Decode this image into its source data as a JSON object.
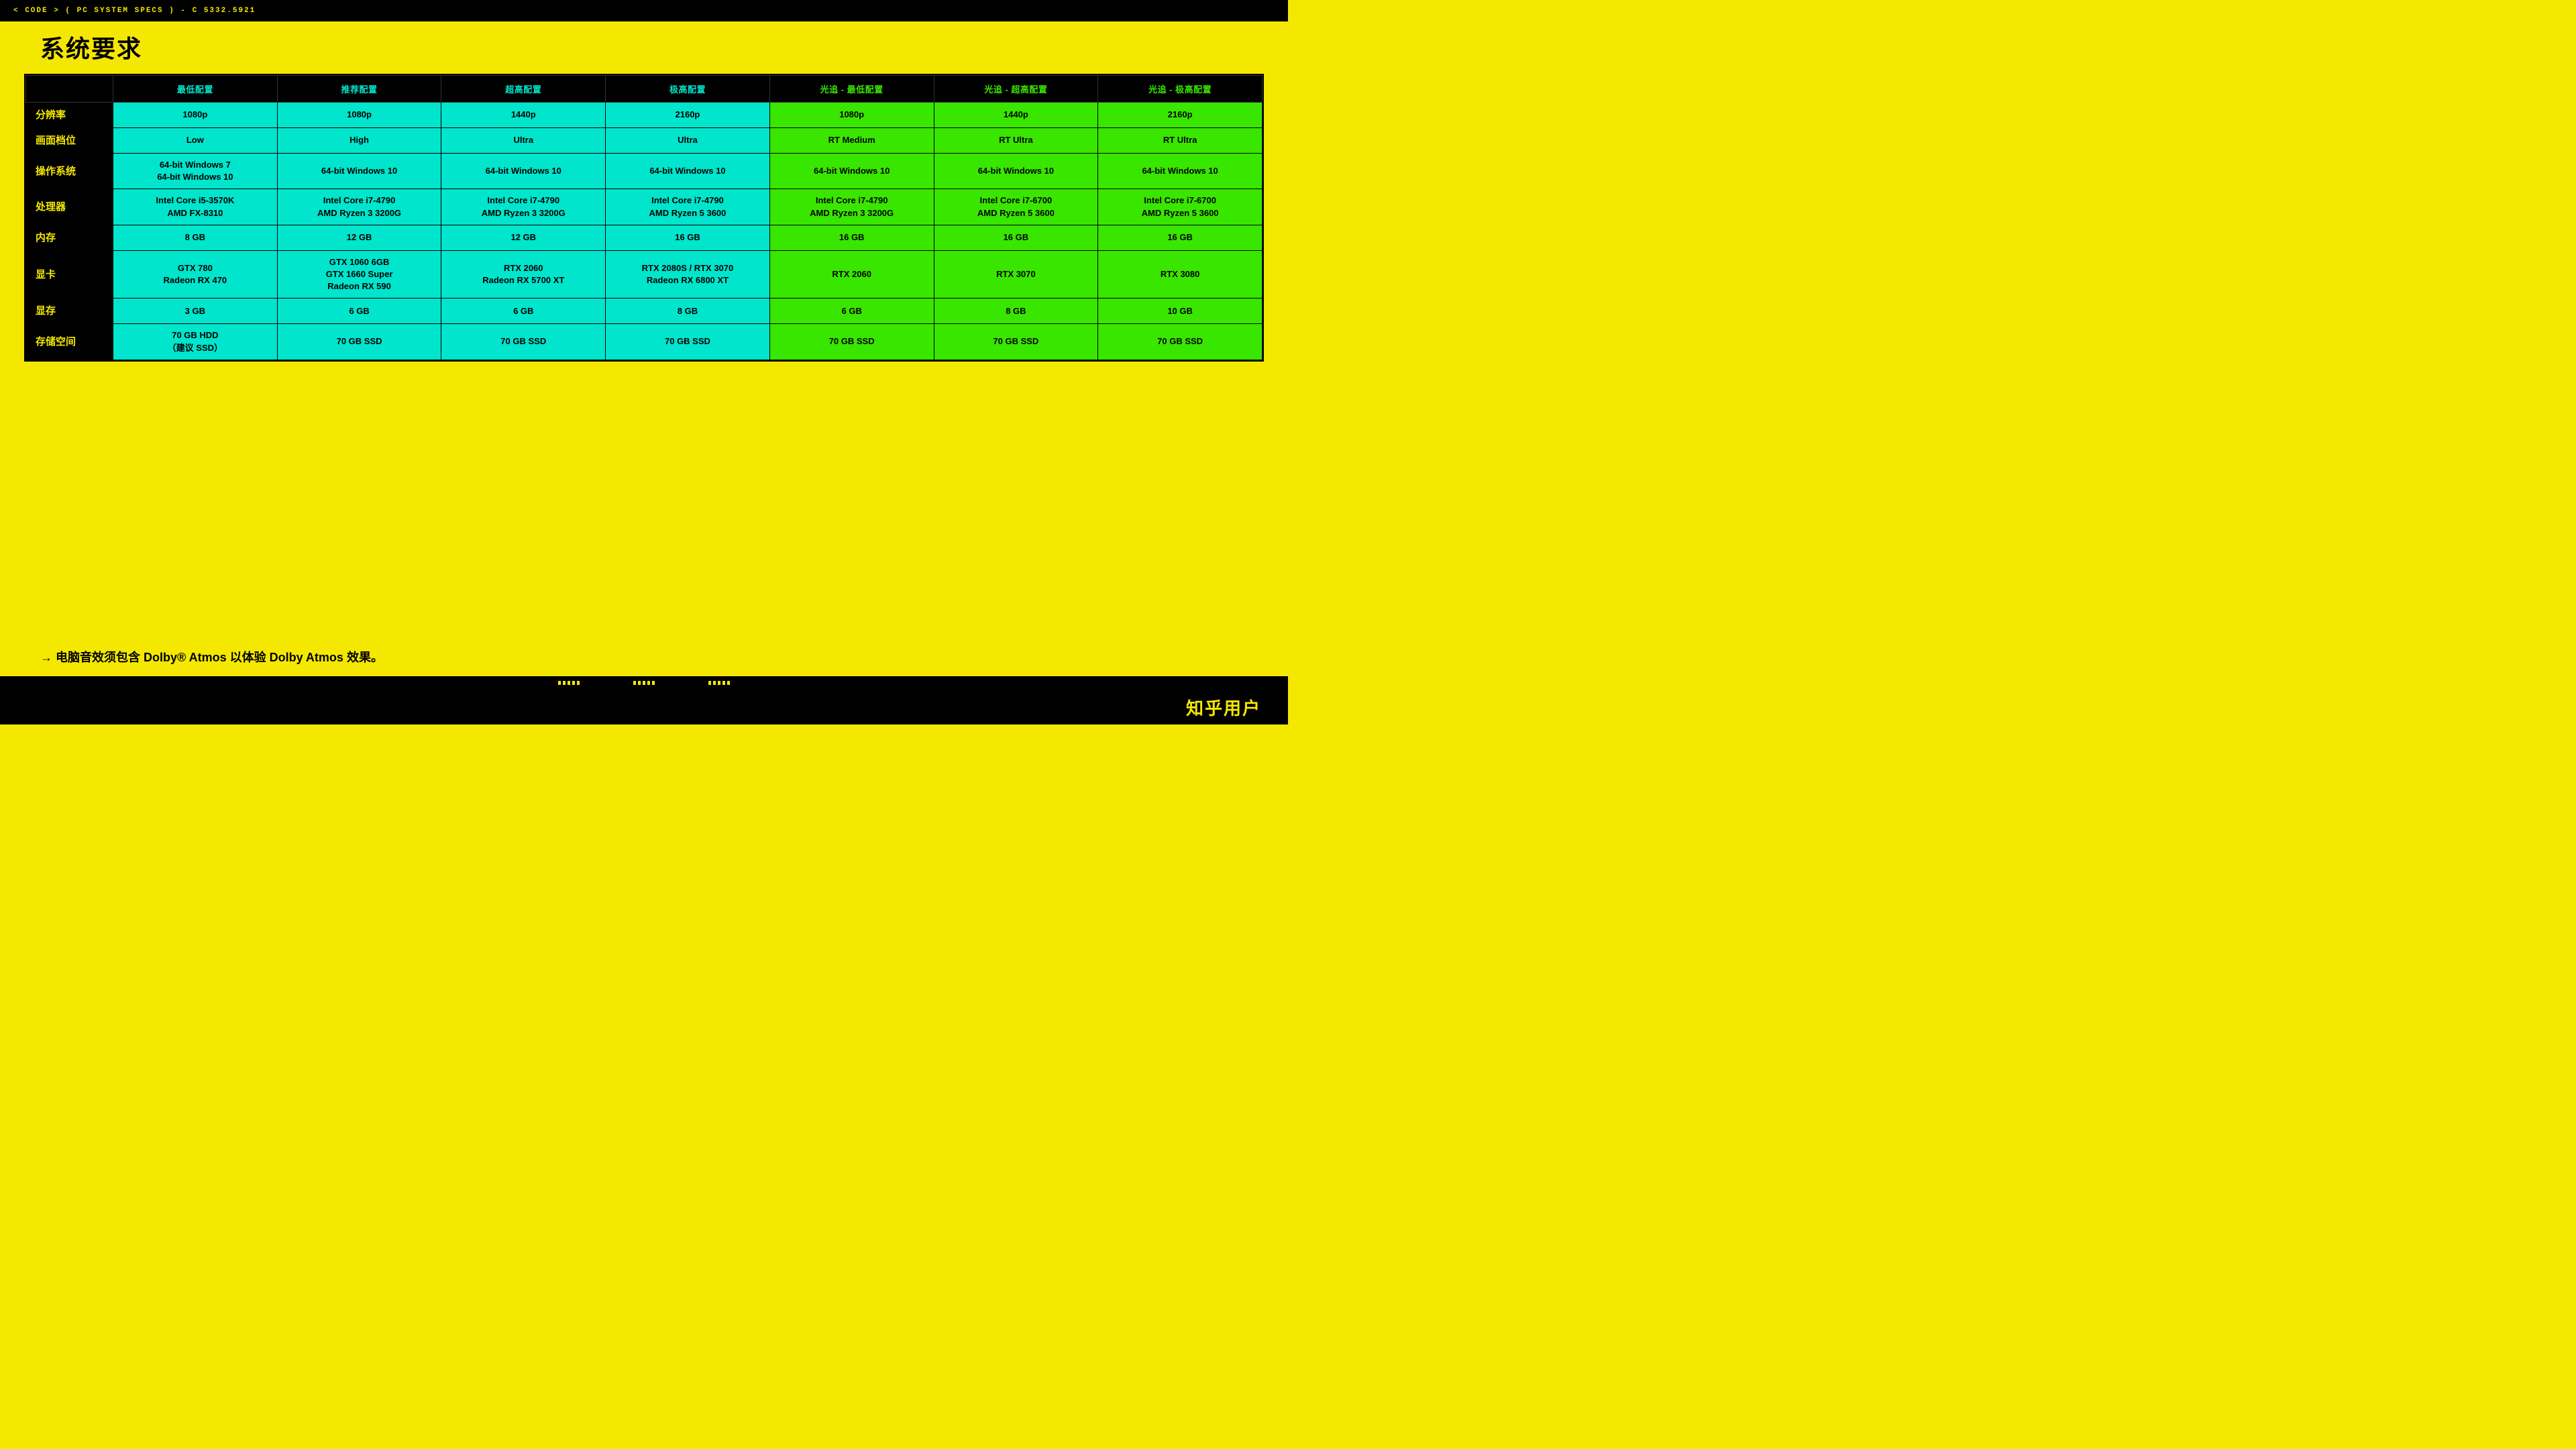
{
  "topbar": {
    "text": "< CODE > ( PC SYSTEM SPECS ) - C 5332.5921"
  },
  "page": {
    "title": "系统要求"
  },
  "table": {
    "headers": [
      {
        "label": "",
        "color": "normal"
      },
      {
        "label": "最低配置",
        "color": "cyan"
      },
      {
        "label": "推荐配置",
        "color": "cyan"
      },
      {
        "label": "超高配置",
        "color": "cyan"
      },
      {
        "label": "极高配置",
        "color": "cyan"
      },
      {
        "label": "光追 - 最低配置",
        "color": "green"
      },
      {
        "label": "光追 - 超高配置",
        "color": "green"
      },
      {
        "label": "光追 - 极高配置",
        "color": "green"
      }
    ],
    "rows": [
      {
        "label": "分辨率",
        "cells": [
          {
            "text": "1080p",
            "type": "cyan"
          },
          {
            "text": "1080p",
            "type": "cyan"
          },
          {
            "text": "1440p",
            "type": "cyan"
          },
          {
            "text": "2160p",
            "type": "cyan"
          },
          {
            "text": "1080p",
            "type": "green"
          },
          {
            "text": "1440p",
            "type": "green"
          },
          {
            "text": "2160p",
            "type": "green"
          }
        ]
      },
      {
        "label": "画面档位",
        "cells": [
          {
            "text": "Low",
            "type": "cyan"
          },
          {
            "text": "High",
            "type": "cyan"
          },
          {
            "text": "Ultra",
            "type": "cyan"
          },
          {
            "text": "Ultra",
            "type": "cyan"
          },
          {
            "text": "RT Medium",
            "type": "green"
          },
          {
            "text": "RT Ultra",
            "type": "green"
          },
          {
            "text": "RT Ultra",
            "type": "green"
          }
        ]
      },
      {
        "label": "操作系统",
        "cells": [
          {
            "text": "64-bit Windows 7\n64-bit Windows 10",
            "type": "cyan"
          },
          {
            "text": "64-bit Windows 10",
            "type": "cyan"
          },
          {
            "text": "64-bit Windows 10",
            "type": "cyan"
          },
          {
            "text": "64-bit Windows 10",
            "type": "cyan"
          },
          {
            "text": "64-bit Windows 10",
            "type": "green"
          },
          {
            "text": "64-bit Windows 10",
            "type": "green"
          },
          {
            "text": "64-bit Windows 10",
            "type": "green"
          }
        ]
      },
      {
        "label": "处理器",
        "cells": [
          {
            "text": "Intel Core i5-3570K\nAMD FX-8310",
            "type": "cyan"
          },
          {
            "text": "Intel Core i7-4790\nAMD Ryzen 3 3200G",
            "type": "cyan"
          },
          {
            "text": "Intel Core i7-4790\nAMD Ryzen 3 3200G",
            "type": "cyan"
          },
          {
            "text": "Intel Core i7-4790\nAMD Ryzen 5 3600",
            "type": "cyan"
          },
          {
            "text": "Intel Core i7-4790\nAMD Ryzen 3 3200G",
            "type": "green"
          },
          {
            "text": "Intel Core i7-6700\nAMD Ryzen 5 3600",
            "type": "green"
          },
          {
            "text": "Intel Core i7-6700\nAMD Ryzen 5 3600",
            "type": "green"
          }
        ]
      },
      {
        "label": "内存",
        "cells": [
          {
            "text": "8 GB",
            "type": "cyan"
          },
          {
            "text": "12 GB",
            "type": "cyan"
          },
          {
            "text": "12 GB",
            "type": "cyan"
          },
          {
            "text": "16 GB",
            "type": "cyan"
          },
          {
            "text": "16 GB",
            "type": "green"
          },
          {
            "text": "16 GB",
            "type": "green"
          },
          {
            "text": "16 GB",
            "type": "green"
          }
        ]
      },
      {
        "label": "显卡",
        "cells": [
          {
            "text": "GTX 780\nRadeon RX 470",
            "type": "cyan"
          },
          {
            "text": "GTX 1060 6GB\nGTX 1660 Super\nRadeon RX 590",
            "type": "cyan"
          },
          {
            "text": "RTX 2060\nRadeon RX 5700 XT",
            "type": "cyan"
          },
          {
            "text": "RTX 2080S / RTX 3070\nRadeon RX 6800 XT",
            "type": "cyan"
          },
          {
            "text": "RTX 2060",
            "type": "green"
          },
          {
            "text": "RTX 3070",
            "type": "green"
          },
          {
            "text": "RTX 3080",
            "type": "green"
          }
        ]
      },
      {
        "label": "显存",
        "cells": [
          {
            "text": "3 GB",
            "type": "cyan"
          },
          {
            "text": "6 GB",
            "type": "cyan"
          },
          {
            "text": "6 GB",
            "type": "cyan"
          },
          {
            "text": "8 GB",
            "type": "cyan"
          },
          {
            "text": "6 GB",
            "type": "green"
          },
          {
            "text": "8 GB",
            "type": "green"
          },
          {
            "text": "10 GB",
            "type": "green"
          }
        ]
      },
      {
        "label": "存储空间",
        "cells": [
          {
            "text": "70 GB HDD\n（建议 SSD）",
            "type": "cyan"
          },
          {
            "text": "70 GB SSD",
            "type": "cyan"
          },
          {
            "text": "70 GB SSD",
            "type": "cyan"
          },
          {
            "text": "70 GB SSD",
            "type": "cyan"
          },
          {
            "text": "70 GB SSD",
            "type": "green"
          },
          {
            "text": "70 GB SSD",
            "type": "green"
          },
          {
            "text": "70 GB SSD",
            "type": "green"
          }
        ]
      }
    ]
  },
  "footnote": {
    "text": "→ 电脑音效须包含 Dolby® Atmos 以体验 Dolby Atmos 效果。"
  },
  "watermark": {
    "text": "知乎用户"
  }
}
